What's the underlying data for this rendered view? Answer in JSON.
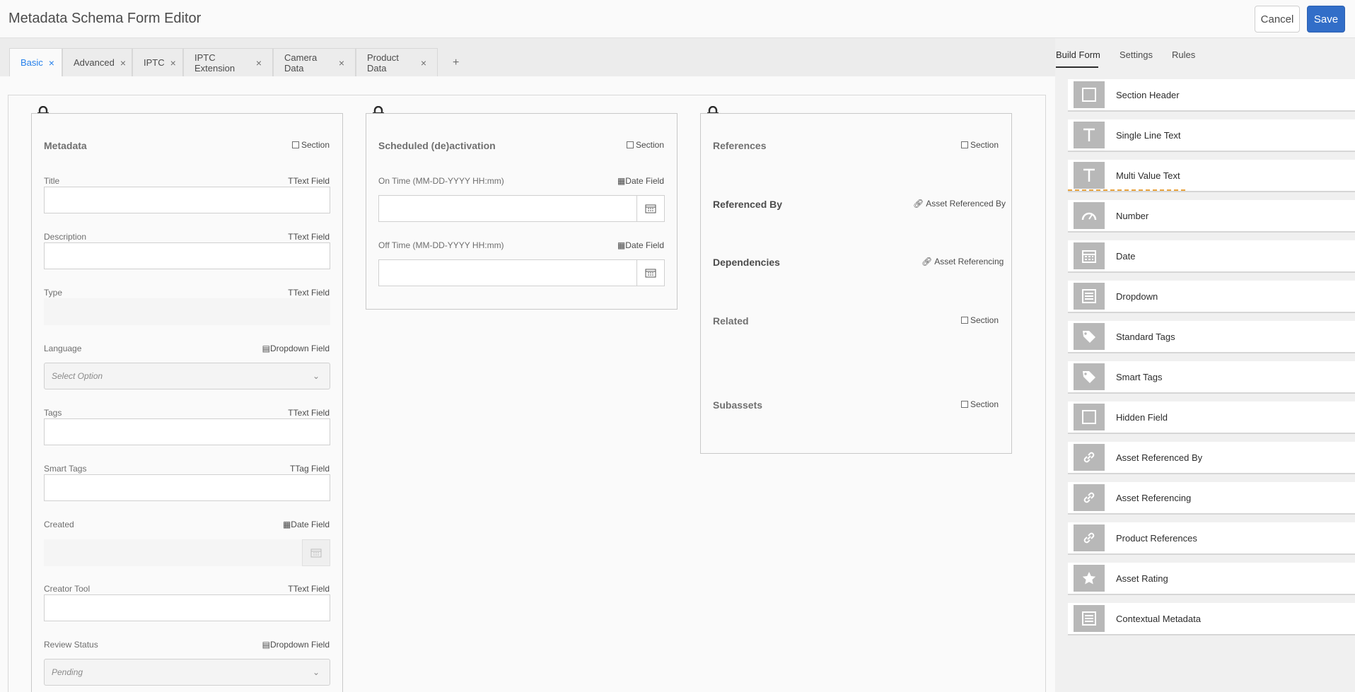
{
  "header": {
    "title": "Metadata Schema Form Editor",
    "cancel_label": "Cancel",
    "save_label": "Save"
  },
  "tabs": [
    {
      "label": "Basic",
      "active": true
    },
    {
      "label": "Advanced"
    },
    {
      "label": "IPTC"
    },
    {
      "label": "IPTC Extension"
    },
    {
      "label": "Camera Data"
    },
    {
      "label": "Product Data"
    }
  ],
  "tab_add": "+",
  "tab_close": "×",
  "col1": {
    "title": "Metadata",
    "type": "Section",
    "fields": [
      {
        "label": "Title",
        "type": "Text Field"
      },
      {
        "label": "Description",
        "type": "Text Field"
      },
      {
        "label": "Type",
        "type": "Text Field"
      },
      {
        "label": "Language",
        "type": "Dropdown Field",
        "placeholder": "Select Option"
      },
      {
        "label": "Tags",
        "type": "Text Field"
      },
      {
        "label": "Smart Tags",
        "type": "Tag Field"
      },
      {
        "label": "Created",
        "type": "Date Field"
      },
      {
        "label": "Creator Tool",
        "type": "Text Field"
      },
      {
        "label": "Review Status",
        "type": "Dropdown Field",
        "placeholder": "Pending"
      }
    ]
  },
  "col2": {
    "title": "Scheduled (de)activation",
    "type": "Section",
    "fields": [
      {
        "label": "On Time (MM-DD-YYYY HH:mm)",
        "type": "Date Field"
      },
      {
        "label": "Off Time (MM-DD-YYYY HH:mm)",
        "type": "Date Field"
      }
    ]
  },
  "col3": {
    "sections": [
      {
        "title": "References",
        "type": "Section"
      },
      {
        "title": "Referenced By",
        "type": "Asset Referenced By"
      },
      {
        "title": "Dependencies",
        "type": "Asset Referencing"
      },
      {
        "title": "Related",
        "type": "Section"
      },
      {
        "title": "Subassets",
        "type": "Section"
      }
    ]
  },
  "right_panel": {
    "tabs": [
      "Build Form",
      "Settings",
      "Rules"
    ],
    "components": [
      {
        "label": "Section Header",
        "icon": "square-icon"
      },
      {
        "label": "Single Line Text",
        "icon": "text-t-icon"
      },
      {
        "label": "Multi Value Text",
        "icon": "text-t-icon"
      },
      {
        "label": "Number",
        "icon": "gauge-icon"
      },
      {
        "label": "Date",
        "icon": "calendar-icon"
      },
      {
        "label": "Dropdown",
        "icon": "dropdown-list-icon"
      },
      {
        "label": "Standard Tags",
        "icon": "tag-icon"
      },
      {
        "label": "Smart Tags",
        "icon": "tag-icon"
      },
      {
        "label": "Hidden Field",
        "icon": "square-icon"
      },
      {
        "label": "Asset Referenced By",
        "icon": "link-icon"
      },
      {
        "label": "Asset Referencing",
        "icon": "link-icon"
      },
      {
        "label": "Product References",
        "icon": "link-icon"
      },
      {
        "label": "Asset Rating",
        "icon": "star-icon"
      },
      {
        "label": "Contextual Metadata",
        "icon": "dropdown-list-icon"
      }
    ]
  },
  "colors": {
    "accent": "#2680eb",
    "save": "#326ec8",
    "drop_indicator": "#e8a33d"
  }
}
